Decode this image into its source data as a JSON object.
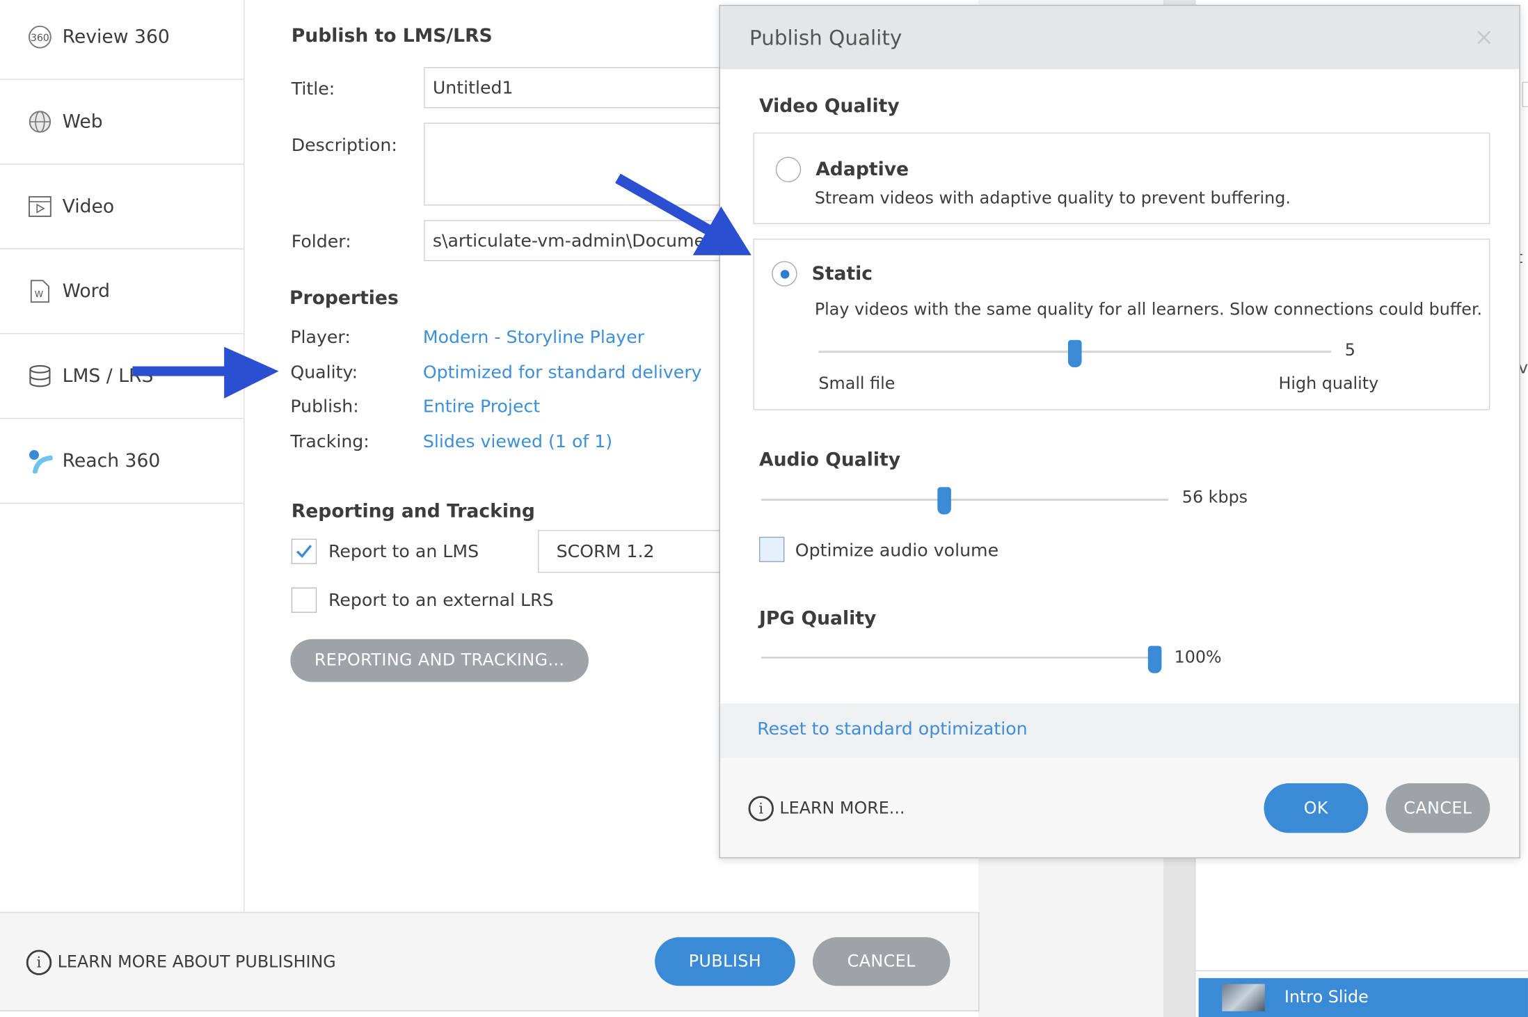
{
  "sidebar": {
    "items": [
      {
        "label": "Review 360",
        "icon": "review-360-icon"
      },
      {
        "label": "Web",
        "icon": "globe-icon"
      },
      {
        "label": "Video",
        "icon": "video-icon"
      },
      {
        "label": "Word",
        "icon": "word-document-icon"
      },
      {
        "label": "LMS / LRS",
        "icon": "database-icon"
      },
      {
        "label": "Reach 360",
        "icon": "reach-360-icon"
      }
    ],
    "selected_index": 4
  },
  "publish": {
    "heading": "Publish to LMS/LRS",
    "title_label": "Title:",
    "title_value": "Untitled1",
    "description_label": "Description:",
    "description_value": "",
    "folder_label": "Folder:",
    "folder_value": "s\\articulate-vm-admin\\Documents",
    "properties_heading": "Properties",
    "player_label": "Player:",
    "player_value": "Modern - Storyline Player",
    "quality_label": "Quality:",
    "quality_value": "Optimized for standard delivery",
    "publish_label": "Publish:",
    "publish_value": "Entire Project",
    "tracking_label": "Tracking:",
    "tracking_value": "Slides viewed (1 of 1)",
    "reporting_heading": "Reporting and Tracking",
    "report_lms_label": "Report to an LMS",
    "report_lms_checked": true,
    "lms_standard": "SCORM 1.2",
    "report_lrs_label": "Report to an external LRS",
    "report_lrs_checked": false,
    "reporting_button": "REPORTING AND TRACKING..."
  },
  "footer": {
    "learn_more": "LEARN MORE ABOUT PUBLISHING",
    "publish_button": "PUBLISH",
    "cancel_button": "CANCEL"
  },
  "dialog": {
    "title": "Publish Quality",
    "close_glyph": "×",
    "video_quality_heading": "Video Quality",
    "adaptive_title": "Adaptive",
    "adaptive_desc": "Stream videos with adaptive quality to prevent buffering.",
    "static_title": "Static",
    "static_desc": "Play videos with the same quality for all learners. Slow connections could buffer.",
    "static_selected": true,
    "video_slider_value": "5",
    "video_slider_fraction": 0.5,
    "video_slider_min_label": "Small file",
    "video_slider_max_label": "High quality",
    "audio_quality_heading": "Audio Quality",
    "audio_value": "56 kbps",
    "audio_slider_fraction": 0.45,
    "optimize_audio_label": "Optimize audio volume",
    "optimize_audio_checked": false,
    "jpg_quality_heading": "JPG Quality",
    "jpg_value": "100%",
    "jpg_slider_fraction": 1.0,
    "reset_link": "Reset to standard optimization",
    "learn_more": "LEARN MORE...",
    "ok_button": "OK",
    "cancel_button": "CANCEL"
  },
  "background_app": {
    "slide_label": "Intro Slide",
    "edge_glyph_1": "t",
    "edge_glyph_2": "v"
  },
  "colors": {
    "accent": "#3a8ad6",
    "link": "#3d8fd9",
    "arrow": "#2b4fd1",
    "gray_button": "#9ea3a8"
  }
}
